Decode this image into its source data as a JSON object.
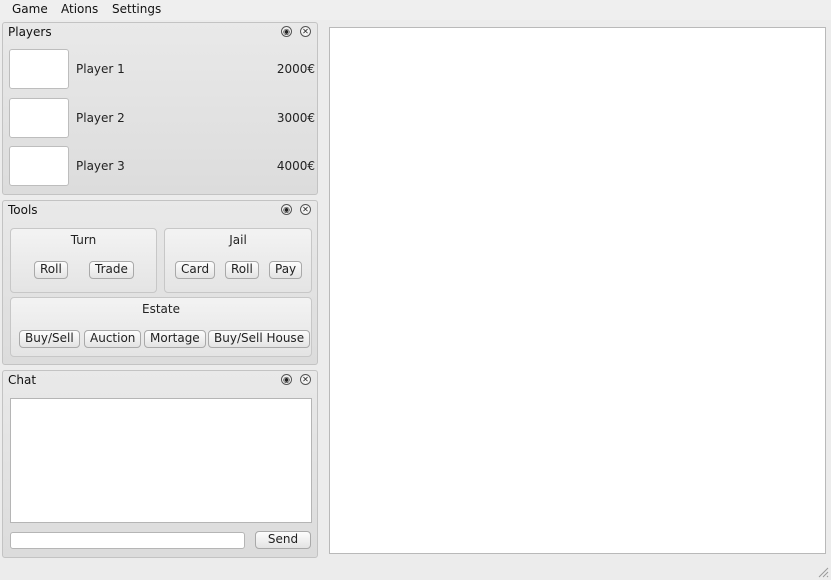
{
  "menu": [
    "Game",
    "Ations",
    "Settings"
  ],
  "players_panel": {
    "title": "Players",
    "players": [
      {
        "name": "Player 1",
        "money": "2000€"
      },
      {
        "name": "Player 2",
        "money": "3000€"
      },
      {
        "name": "Player 3",
        "money": "4000€"
      }
    ]
  },
  "tools_panel": {
    "title": "Tools",
    "turn": {
      "title": "Turn",
      "roll": "Roll",
      "trade": "Trade"
    },
    "jail": {
      "title": "Jail",
      "card": "Card",
      "roll": "Roll",
      "pay": "Pay"
    },
    "estate": {
      "title": "Estate",
      "buy_sell": "Buy/Sell",
      "auction": "Auction",
      "mortage": "Mortage",
      "buy_sell_house": "Buy/Sell House"
    }
  },
  "chat_panel": {
    "title": "Chat",
    "message_placeholder": "",
    "send_label": "Send"
  },
  "icons": {
    "float": "float-icon",
    "close": "close-icon"
  }
}
